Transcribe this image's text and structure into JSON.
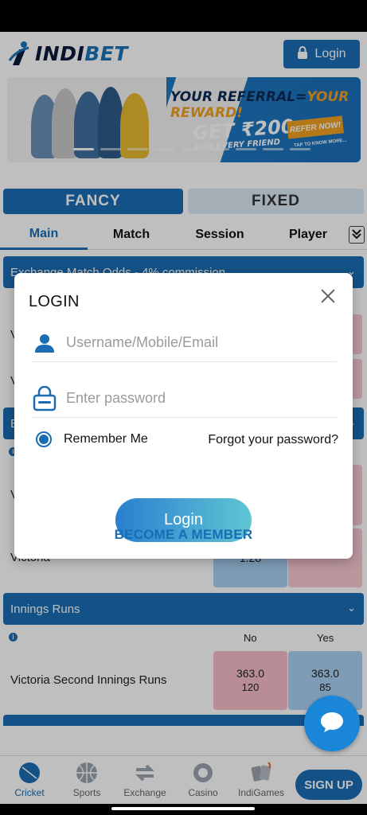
{
  "brand": {
    "name_part1": "INDI",
    "name_part2": "BET"
  },
  "header": {
    "login_label": "Login"
  },
  "banner": {
    "headline_part1": "YOUR REFERRAL=",
    "headline_part2": "YOUR REWARD!",
    "offer": "GET ₹200",
    "offer_sub": "FOR EVERY FRIEND",
    "cta": "REFER NOW!",
    "cta_sub": "TAP TO KNOW MORE..."
  },
  "segments": {
    "fancy": "FANCY",
    "fixed": "FIXED"
  },
  "subtabs": [
    "Main",
    "Match",
    "Session",
    "Player"
  ],
  "markets": {
    "exchange_title": "Exchange Match Odds - 4% commission",
    "row_peek_label": "Victoria",
    "cell_peek_value": "1.28",
    "innings_title": "Innings Runs",
    "col_no": "No",
    "col_yes": "Yes",
    "innings_row": {
      "label": "Victoria Second Innings Runs",
      "no_value": "363.0",
      "no_size": "120",
      "yes_value": "363.0",
      "yes_size": "85"
    }
  },
  "dialog": {
    "title": "LOGIN",
    "username_placeholder": "Username/Mobile/Email",
    "password_placeholder": "Enter password",
    "remember_label": "Remember Me",
    "forgot_label": "Forgot your password?",
    "login_button": "Login",
    "member_link": "BECOME A MEMBER"
  },
  "bottom_nav": [
    {
      "label": "Cricket",
      "icon": "cricket-ball-icon"
    },
    {
      "label": "Sports",
      "icon": "basketball-icon"
    },
    {
      "label": "Exchange",
      "icon": "exchange-arrows-icon"
    },
    {
      "label": "Casino",
      "icon": "casino-chip-icon"
    },
    {
      "label": "IndiGames",
      "icon": "cards-icon"
    }
  ],
  "signup_label": "SIGN UP",
  "colors": {
    "primary": "#1a6db3",
    "no_cell": "#f7bcc7",
    "yes_cell": "#a8d0f3",
    "accent": "#f0a020"
  }
}
